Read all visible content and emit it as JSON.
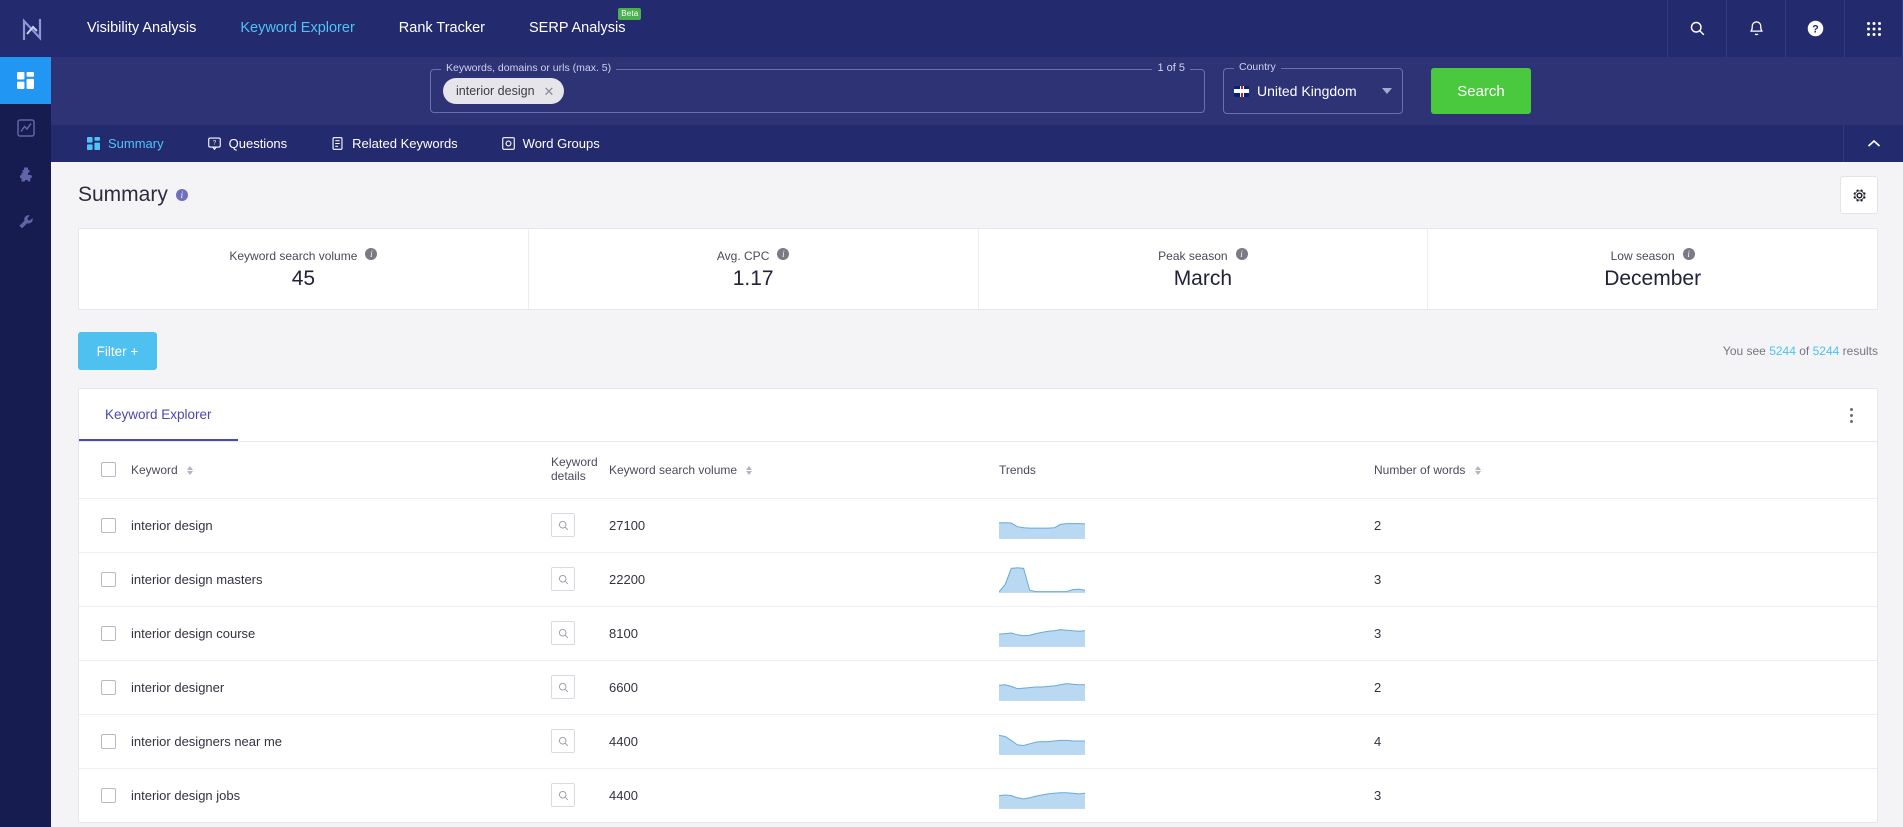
{
  "brand": {
    "logo_icon": "n-chart-logo"
  },
  "topnav": {
    "links": [
      {
        "label": "Visibility Analysis",
        "active": false,
        "badge": ""
      },
      {
        "label": "Keyword Explorer",
        "active": true,
        "badge": ""
      },
      {
        "label": "Rank Tracker",
        "active": false,
        "badge": ""
      },
      {
        "label": "SERP Analysis",
        "active": false,
        "badge": "Beta"
      }
    ],
    "actions": [
      {
        "name": "search-icon",
        "label": "Search"
      },
      {
        "name": "bell-icon",
        "label": "Notifications"
      },
      {
        "name": "help-icon",
        "label": "Help"
      },
      {
        "name": "apps-grid-icon",
        "label": "Apps"
      }
    ]
  },
  "sidebar": {
    "items": [
      {
        "name": "dashboard-icon",
        "label": "Dashboard",
        "active": true
      },
      {
        "name": "analytics-chart-icon",
        "label": "Analytics",
        "active": false
      },
      {
        "name": "puzzle-icon",
        "label": "Integrations",
        "active": false
      },
      {
        "name": "wrench-icon",
        "label": "Tools",
        "active": false
      }
    ]
  },
  "search": {
    "keywords_legend": "Keywords, domains or urls (max. 5)",
    "counter": "1 of 5",
    "chips": [
      {
        "label": "interior design",
        "remove_icon": "close-icon"
      }
    ],
    "country_legend": "Country",
    "country_value": "United Kingdom",
    "country_flag": "uk-flag-icon",
    "search_button": "Search",
    "colors": {
      "search_button": "#4ac93e",
      "bar_bg": "#2e3376"
    }
  },
  "section_tabs": {
    "items": [
      {
        "label": "Summary",
        "icon": "grid-squares-icon",
        "active": true
      },
      {
        "label": "Questions",
        "icon": "question-bubble-icon",
        "active": false
      },
      {
        "label": "Related Keywords",
        "icon": "document-icon",
        "active": false
      },
      {
        "label": "Word Groups",
        "icon": "word-groups-icon",
        "active": false
      }
    ],
    "collapse_icon": "chevron-up-icon"
  },
  "page": {
    "title": "Summary",
    "title_info_icon": "info-icon",
    "settings_icon": "gear-icon"
  },
  "stats": [
    {
      "label": "Keyword search volume",
      "value": "45",
      "info_icon": "info-icon"
    },
    {
      "label": "Avg. CPC",
      "value": "1.17",
      "info_icon": "info-icon"
    },
    {
      "label": "Peak season",
      "value": "March",
      "info_icon": "info-icon"
    },
    {
      "label": "Low season",
      "value": "December",
      "info_icon": "info-icon"
    }
  ],
  "toolbar": {
    "filter_label": "Filter +",
    "results_prefix": "You see",
    "results_shown": "5244",
    "results_middle": "of",
    "results_total": "5244",
    "results_suffix": "results"
  },
  "table": {
    "tab_label": "Keyword Explorer",
    "menu_icon": "kebab-menu-icon",
    "columns": [
      {
        "label": "",
        "name": "select-all"
      },
      {
        "label": "Keyword",
        "sortable": true
      },
      {
        "label": "Keyword details",
        "sortable": false
      },
      {
        "label": "Keyword search volume",
        "sortable": true
      },
      {
        "label": "Trends",
        "sortable": false
      },
      {
        "label": "Number of words",
        "sortable": true
      }
    ],
    "rows": [
      {
        "keyword": "interior design",
        "volume": "27100",
        "words": "2",
        "trend": [
          58,
          58,
          57,
          44,
          40,
          39,
          39,
          39,
          39,
          40,
          52,
          55,
          55,
          55,
          54
        ]
      },
      {
        "keyword": "interior design masters",
        "volume": "22200",
        "words": "3",
        "trend": [
          4,
          30,
          88,
          90,
          88,
          10,
          5,
          5,
          5,
          5,
          5,
          5,
          12,
          14,
          10
        ]
      },
      {
        "keyword": "interior design course",
        "volume": "8100",
        "words": "3",
        "trend": [
          46,
          48,
          50,
          44,
          40,
          42,
          48,
          52,
          56,
          58,
          62,
          60,
          58,
          56,
          58
        ]
      },
      {
        "keyword": "interior designer",
        "volume": "6600",
        "words": "2",
        "trend": [
          56,
          58,
          52,
          44,
          46,
          48,
          50,
          50,
          52,
          54,
          58,
          62,
          60,
          58,
          58
        ]
      },
      {
        "keyword": "interior designers near me",
        "volume": "4400",
        "words": "4",
        "trend": [
          70,
          66,
          52,
          36,
          34,
          40,
          46,
          48,
          48,
          50,
          52,
          52,
          50,
          50,
          50
        ]
      },
      {
        "keyword": "interior design jobs",
        "volume": "4400",
        "words": "3",
        "trend": [
          48,
          50,
          48,
          40,
          36,
          40,
          46,
          50,
          54,
          56,
          58,
          58,
          56,
          54,
          56
        ]
      }
    ]
  },
  "colors": {
    "nav_bg": "#242a6e",
    "searchbar_bg": "#2e3376",
    "sidebar_bg": "#161b50",
    "accent_blue": "#4fc3f7",
    "filter_blue": "#4ec1f0",
    "tab_purple": "#4b47b5",
    "spark_fill": "#b9d9f2",
    "spark_line": "#6aa9d8"
  }
}
